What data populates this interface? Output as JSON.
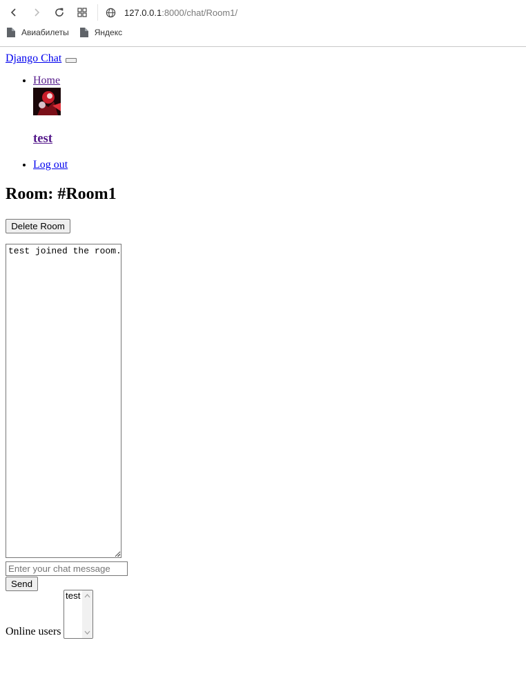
{
  "browser": {
    "url_host": "127.0.0.1",
    "url_path": ":8000/chat/Room1/",
    "bookmarks": [
      {
        "label": "Авиабилеты",
        "icon": "document-icon"
      },
      {
        "label": "Яндекс",
        "icon": "document-icon"
      }
    ]
  },
  "navbar": {
    "brand": "Django Chat",
    "items": {
      "home": "Home",
      "username": "test",
      "logout": "Log out"
    }
  },
  "room": {
    "title": "Room: #Room1",
    "delete_label": "Delete Room",
    "log": "test joined the room.",
    "input_placeholder": "Enter your chat message",
    "send_label": "Send",
    "online_label": "Online users",
    "online_users": [
      "test"
    ]
  }
}
